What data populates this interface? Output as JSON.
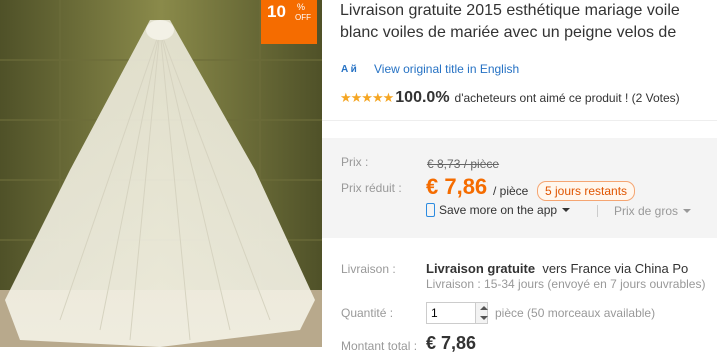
{
  "badge": {
    "value": "10",
    "percent": "%",
    "off": "OFF",
    "color": "#f56c00"
  },
  "product": {
    "title_line1": "Livraison gratuite 2015 esthétique mariage voile",
    "title_line2": "blanc voiles de mariée avec un peigne velos de"
  },
  "original_title": {
    "icon": "translate-icon",
    "icon_text": "A й",
    "link": "View original title in English"
  },
  "rating": {
    "stars": "★★★★★",
    "percent": "100.0%",
    "text": "d'acheteurs ont aimé ce produit ! (2 Votes)"
  },
  "price": {
    "label": "Prix :",
    "old": "€ 8,73 / pièce",
    "discount_label": "Prix réduit :",
    "current": "€ 7,86",
    "unit": "/ pièce",
    "days_left": "5 jours restants",
    "app_link": "Save more on the app",
    "wholesale": "Prix de gros"
  },
  "shipping": {
    "label": "Livraison :",
    "free": "Livraison gratuite",
    "to": "vers  France via China Po",
    "detail": "Livraison : 15-34 jours (envoyé en 7 jours ouvrables)"
  },
  "quantity": {
    "label": "Quantité :",
    "value": "1",
    "unit_text": "pièce (50 morceaux available)"
  },
  "total": {
    "label": "Montant total :",
    "value": "€ 7,86"
  },
  "colors": {
    "accent": "#f56c00",
    "link": "#2672c4",
    "star": "#f5a623"
  }
}
